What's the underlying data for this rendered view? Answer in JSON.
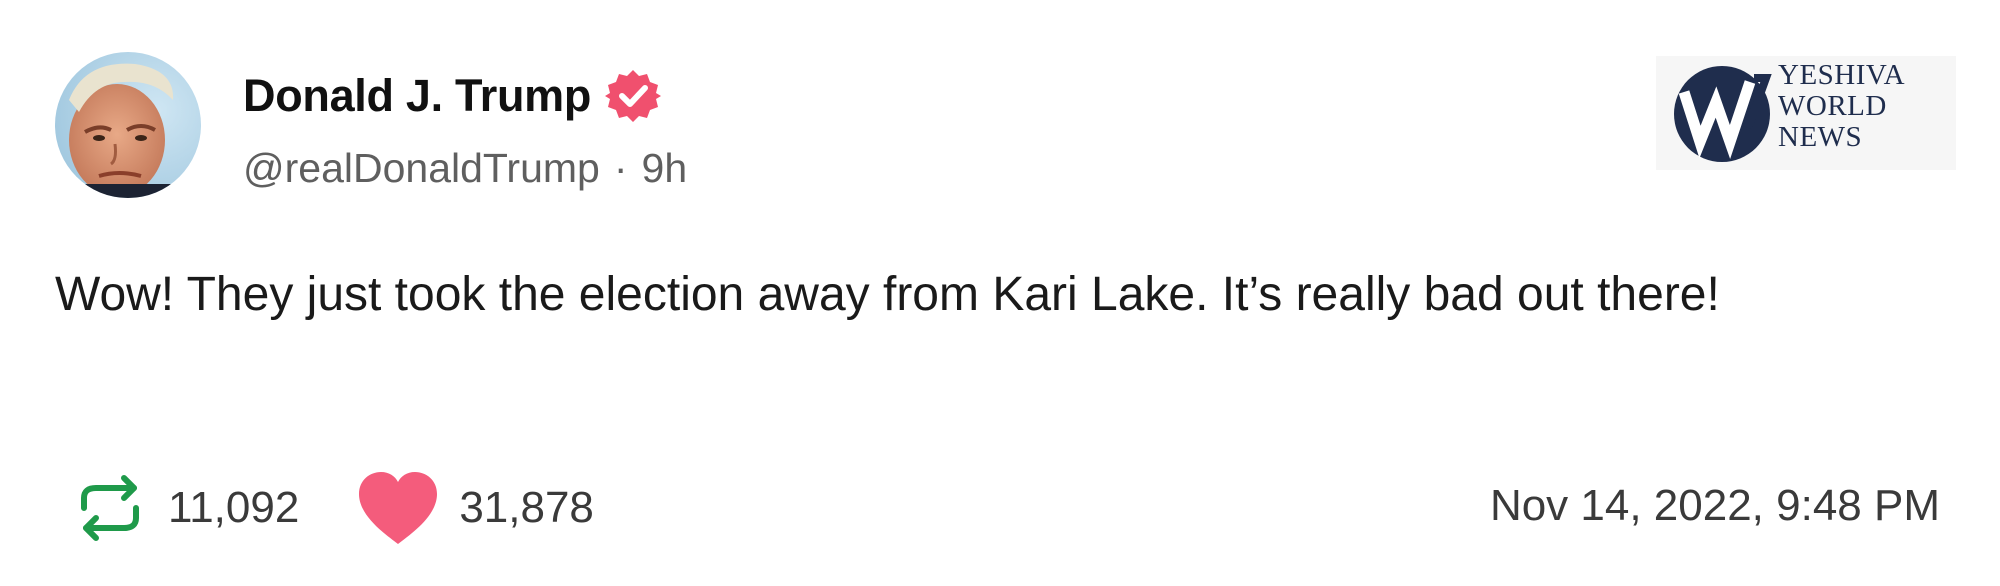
{
  "post": {
    "author": {
      "display_name": "Donald J. Trump",
      "handle": "@realDonaldTrump",
      "separator": "·",
      "relative_time": "9h",
      "verified": true,
      "verified_color": "#f0506e"
    },
    "body": "Wow! They just took the election away from Kari Lake. It’s really bad out there!",
    "stats": {
      "reposts": "11,092",
      "likes": "31,878",
      "repost_color": "#1f9a4a",
      "like_color": "#f45c7c"
    },
    "timestamp": "Nov 14, 2022, 9:48 PM"
  },
  "watermark": {
    "lines": [
      "YESHIVA",
      "WORLD",
      "NEWS"
    ],
    "color": "#1f2d4d"
  },
  "icons": {
    "verified": "verified-badge-icon",
    "repost": "repost-icon",
    "like": "heart-icon",
    "watermark_logo": "yeshiva-world-news-logo"
  }
}
